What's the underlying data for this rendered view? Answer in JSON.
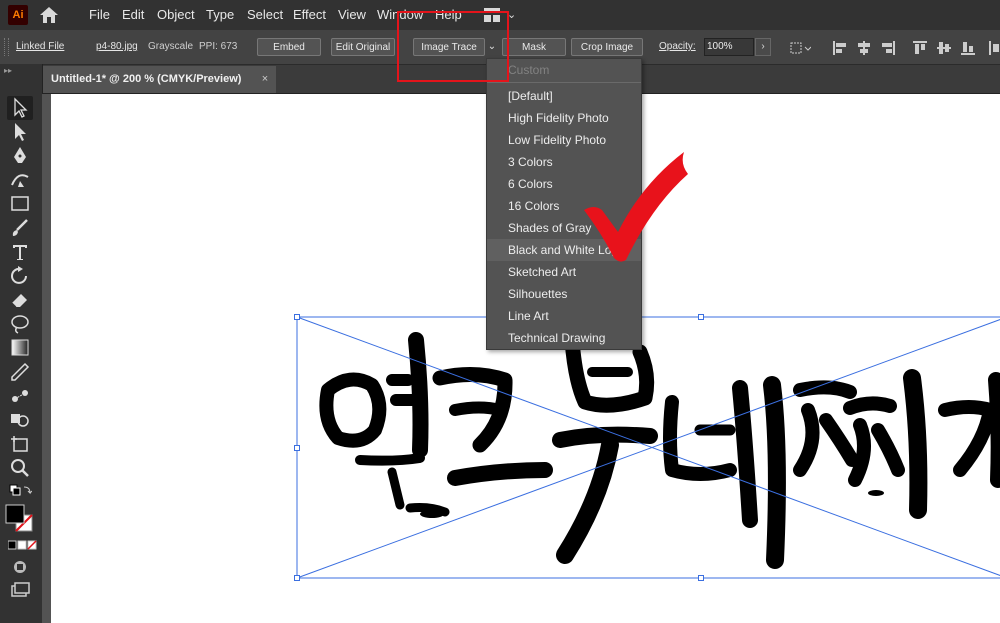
{
  "app": {
    "logo_text": "Ai"
  },
  "menu": [
    "File",
    "Edit",
    "Object",
    "Type",
    "Select",
    "Effect",
    "View",
    "Window",
    "Help"
  ],
  "control_bar": {
    "linked_file": "Linked File",
    "file_name": "p4-80.jpg",
    "color_mode": "Grayscale",
    "ppi": "PPI: 673",
    "embed": "Embed",
    "edit_original": "Edit Original",
    "image_trace": "Image Trace",
    "mask": "Mask",
    "crop_image": "Crop Image",
    "opacity_label": "Opacity:",
    "opacity_value": "100%"
  },
  "document_tab": {
    "title": "Untitled-1* @ 200 % (CMYK/Preview)",
    "close": "×"
  },
  "trace_presets": {
    "items": [
      "Custom",
      "[Default]",
      "High Fidelity Photo",
      "Low Fidelity Photo",
      "3 Colors",
      "6 Colors",
      "16 Colors",
      "Shades of Gray",
      "Black and White Logo",
      "Sketched Art",
      "Silhouettes",
      "Line Art",
      "Technical Drawing"
    ],
    "disabled_item": "Custom",
    "highlighted_item": "Black and White Logo"
  },
  "canvas_artwork": {
    "text": "얼크부대찌개"
  },
  "colors": {
    "highlight_box": "#e4141b",
    "checkmark": "#e8121b",
    "selection": "#3b6fe0",
    "app_accent": "#ff7c00"
  },
  "icons": [
    "home-icon",
    "workspace-icon",
    "chevron-down-icon",
    "selection-tool-icon",
    "direct-selection-tool-icon",
    "pen-tool-icon",
    "curvature-tool-icon",
    "rectangle-tool-icon",
    "paintbrush-tool-icon",
    "type-tool-icon",
    "rotate-tool-icon",
    "eraser-tool-icon",
    "lasso-tool-icon",
    "gradient-tool-icon",
    "eyedropper-tool-icon",
    "blend-tool-icon",
    "shape-builder-tool-icon",
    "artboard-tool-icon",
    "zoom-tool-icon",
    "checkmark-icon"
  ]
}
